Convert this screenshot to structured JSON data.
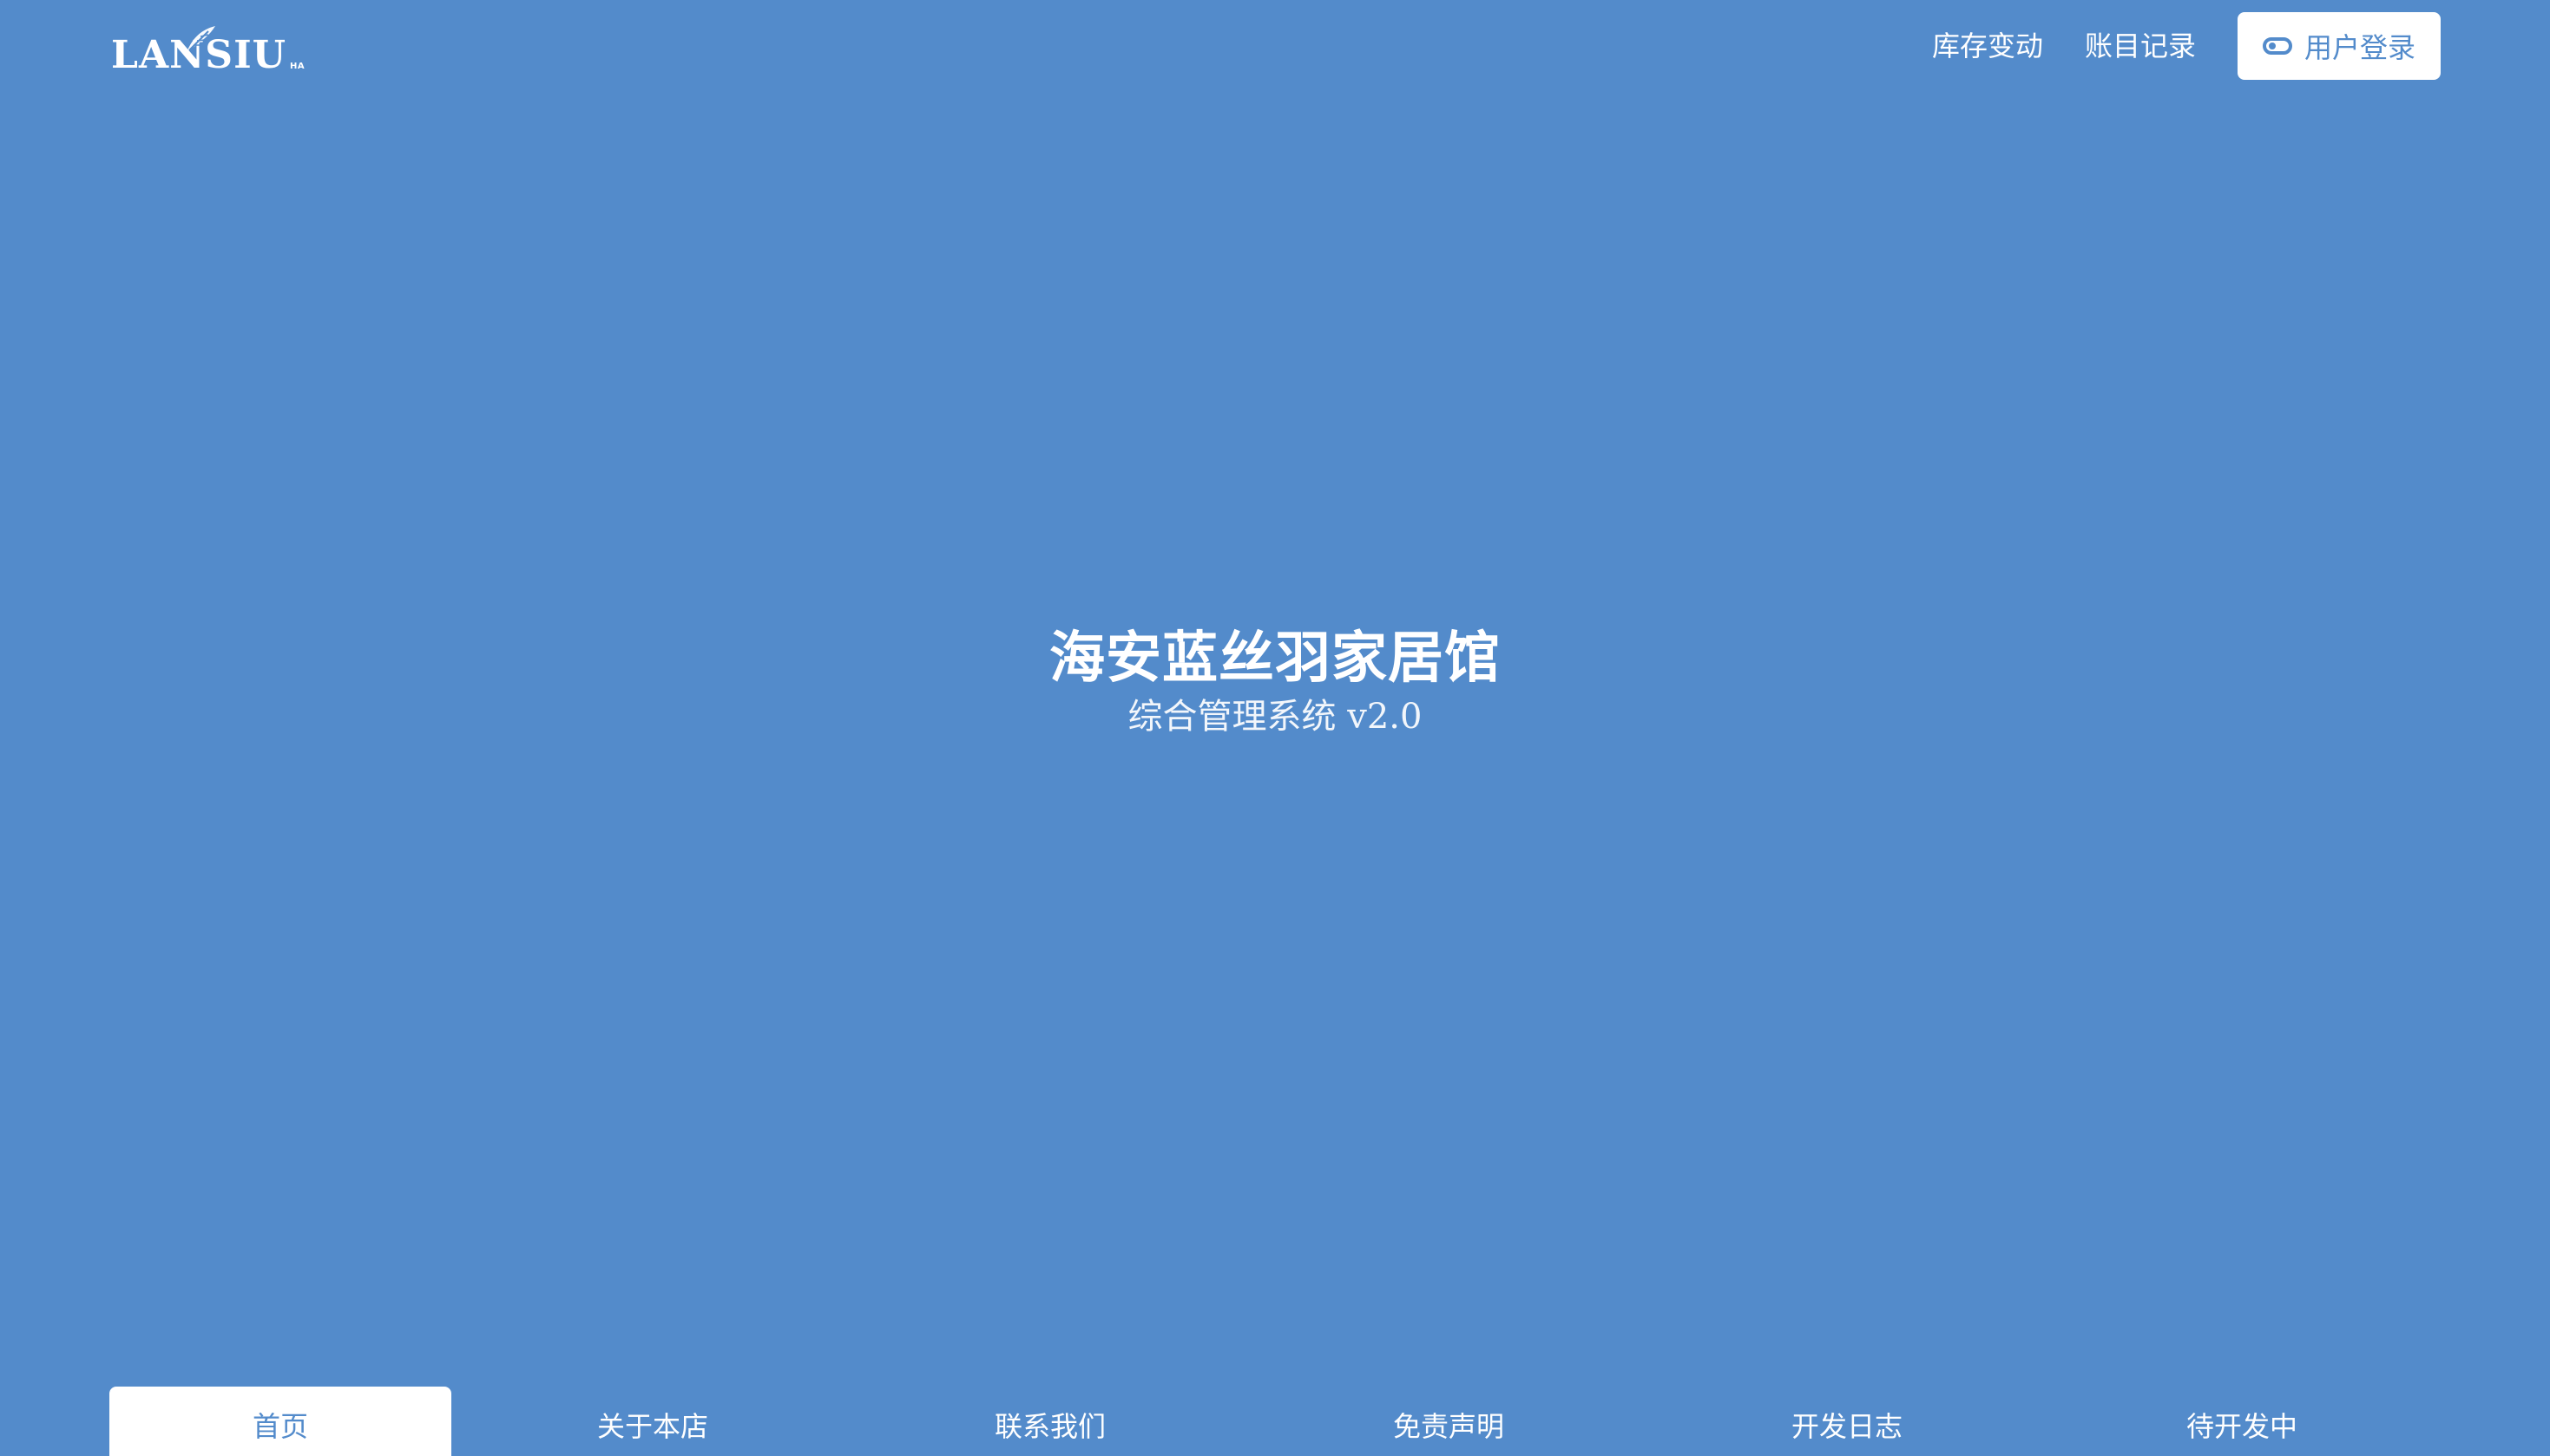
{
  "logo": {
    "text": "LANSIU",
    "sub": "HA",
    "icon": "feather-icon"
  },
  "header": {
    "nav": [
      {
        "label": "库存变动"
      },
      {
        "label": "账目记录"
      }
    ],
    "login": {
      "label": "用户登录",
      "icon": "toggle-icon"
    }
  },
  "hero": {
    "title": "海安蓝丝羽家居馆",
    "subtitle": "综合管理系统 v2.0"
  },
  "tabs": [
    {
      "label": "首页",
      "active": true
    },
    {
      "label": "关于本店"
    },
    {
      "label": "联系我们"
    },
    {
      "label": "免责声明"
    },
    {
      "label": "开发日志"
    },
    {
      "label": "待开发中"
    }
  ],
  "colors": {
    "background": "#538bcb",
    "foreground": "#ffffff"
  }
}
